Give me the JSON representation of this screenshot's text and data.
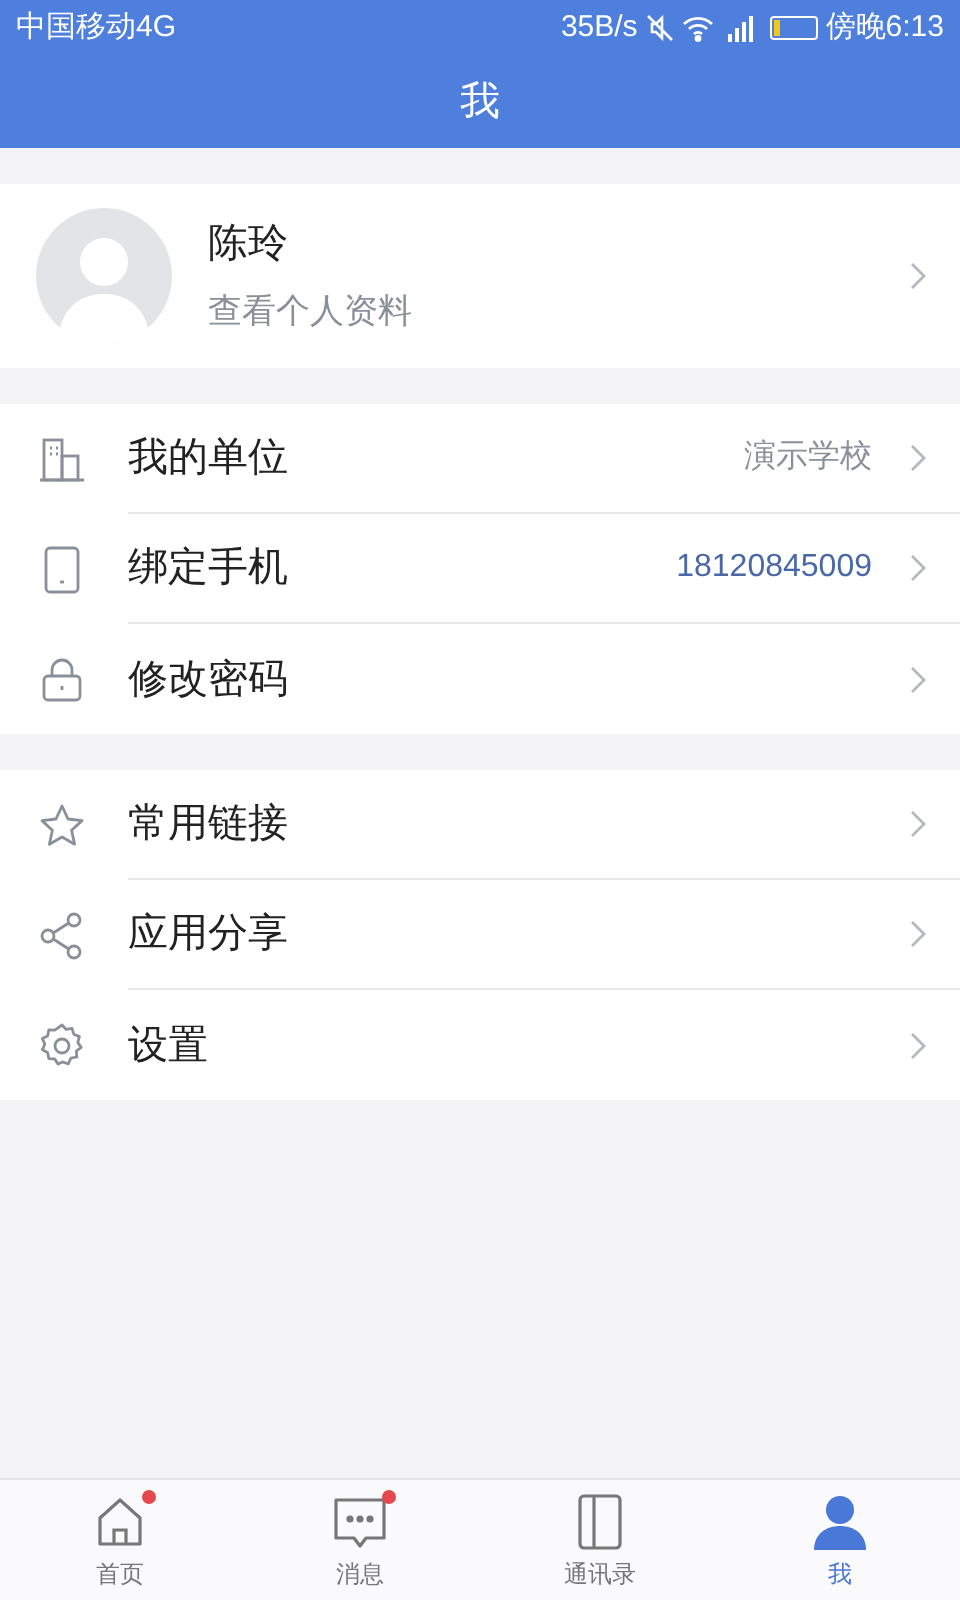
{
  "status_bar": {
    "carrier": "中国移动4G",
    "speed": "35B/s",
    "time": "傍晚6:13"
  },
  "header": {
    "title": "我"
  },
  "profile": {
    "name": "陈玲",
    "subtitle": "查看个人资料"
  },
  "groups": [
    {
      "rows": [
        {
          "kind": "building",
          "label": "我的单位",
          "value": "演示学校",
          "highlight": false
        },
        {
          "kind": "phone",
          "label": "绑定手机",
          "value": "18120845009",
          "highlight": true
        },
        {
          "kind": "lock",
          "label": "修改密码"
        }
      ]
    },
    {
      "rows": [
        {
          "kind": "star",
          "label": "常用链接"
        },
        {
          "kind": "share",
          "label": "应用分享"
        },
        {
          "kind": "gear",
          "label": "设置"
        }
      ]
    }
  ],
  "nav": [
    {
      "kind": "home",
      "label": "首页",
      "selected": false,
      "badge": true
    },
    {
      "kind": "message",
      "label": "消息",
      "selected": false,
      "badge": true
    },
    {
      "kind": "contacts",
      "label": "通讯录",
      "selected": false,
      "badge": false
    },
    {
      "kind": "person",
      "label": "我",
      "selected": true,
      "badge": false
    }
  ]
}
